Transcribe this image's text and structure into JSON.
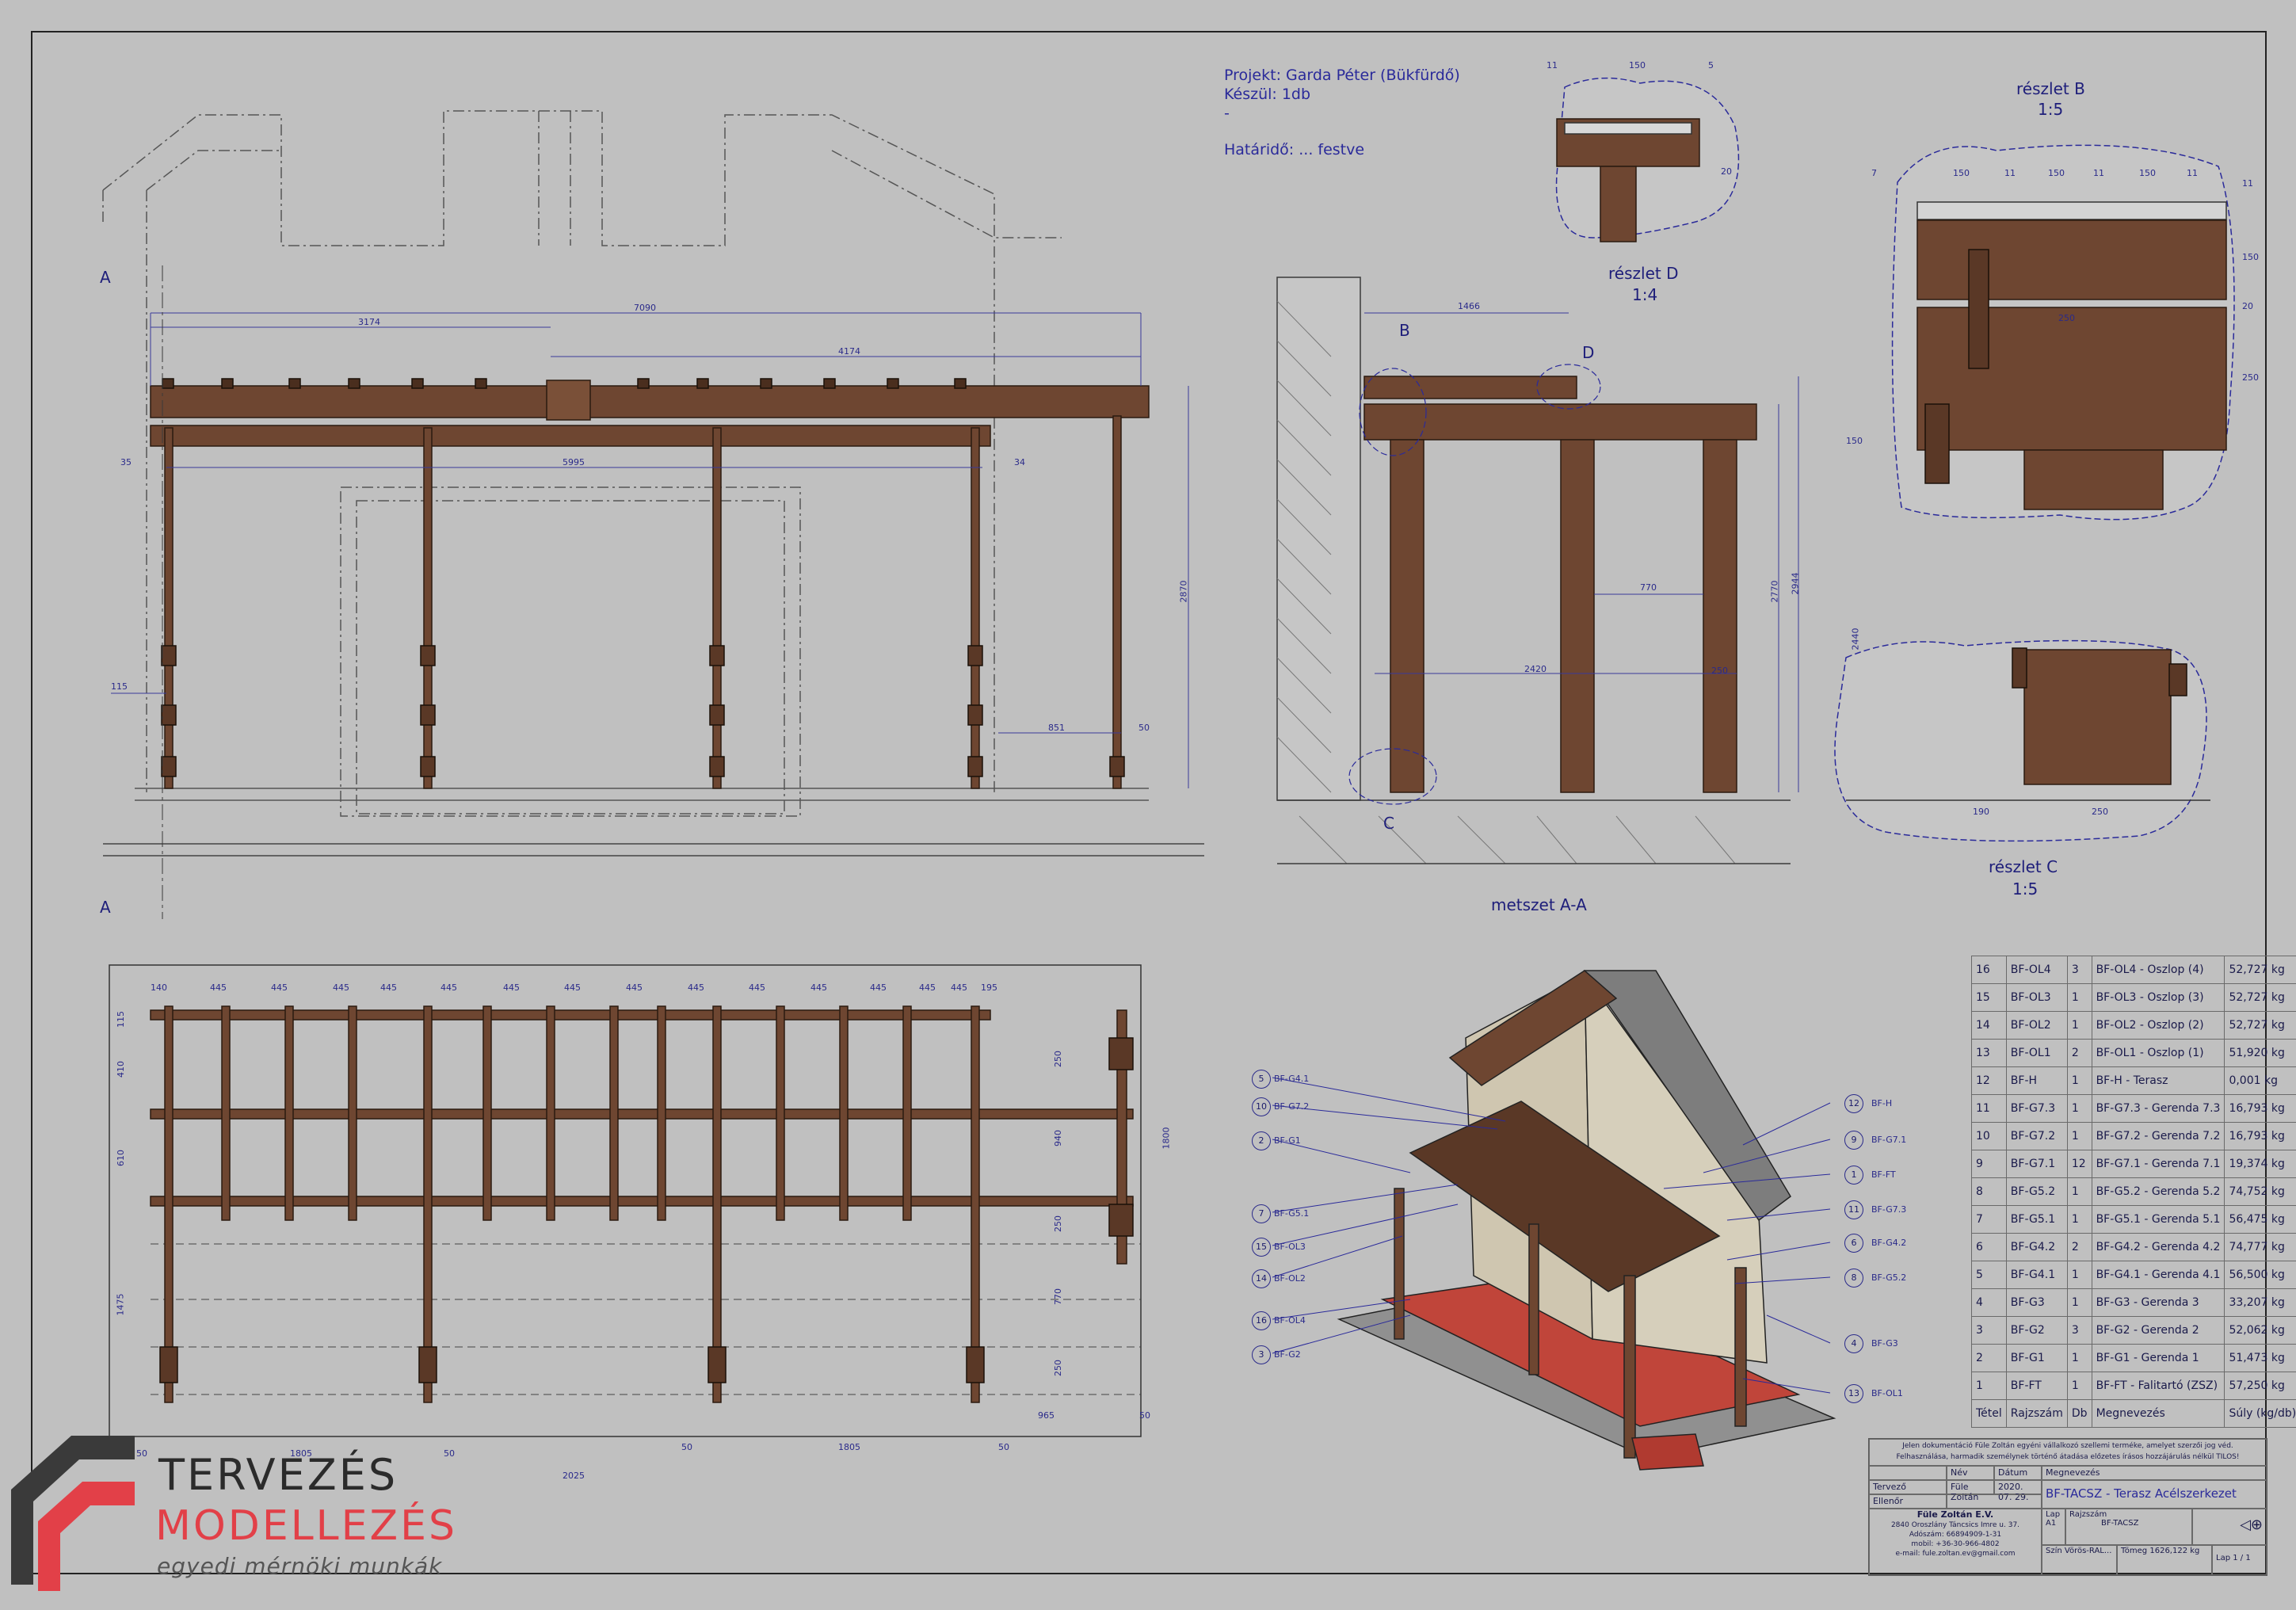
{
  "project": {
    "line1": "Projekt: Garda Péter (Bükfürdő)",
    "line2": "Készül: 1db",
    "line3": "-",
    "line4": "Határidő: ... festve"
  },
  "views": {
    "section_a": "A",
    "section_title": "metszet A-A",
    "detail_b_title": "részlet B",
    "detail_b_scale": "1:5",
    "detail_c_title": "részlet C",
    "detail_c_scale": "1:5",
    "detail_d_title": "részlet D",
    "detail_d_scale": "1:4",
    "callout_b": "B",
    "callout_c": "C",
    "callout_d": "D"
  },
  "dimensions": {
    "front": [
      "3174",
      "7090",
      "4174",
      "5995",
      "35",
      "34",
      "2870",
      "115",
      "851",
      "50"
    ],
    "section": [
      "1466",
      "770",
      "2420",
      "250",
      "2770",
      "2944"
    ],
    "detail_d": [
      "11",
      "150",
      "5",
      "20"
    ],
    "detail_b": [
      "7",
      "150",
      "11",
      "150",
      "11",
      "150",
      "11",
      "11",
      "150",
      "20",
      "250",
      "150",
      "250"
    ],
    "detail_c": [
      "2440",
      "190",
      "250"
    ],
    "plan": [
      "140",
      "445",
      "445",
      "445",
      "445",
      "445",
      "445",
      "445",
      "445",
      "445",
      "445",
      "445",
      "445",
      "445",
      "445",
      "195",
      "115",
      "410",
      "610",
      "1475",
      "250",
      "940",
      "250",
      "1800",
      "770",
      "250",
      "965",
      "50",
      "50",
      "1805",
      "50",
      "50",
      "1805",
      "50",
      "2025"
    ]
  },
  "balloons_left": [
    {
      "n": "5",
      "code": "BF-G4.1"
    },
    {
      "n": "10",
      "code": "BF-G7.2"
    },
    {
      "n": "2",
      "code": "BF-G1"
    },
    {
      "n": "7",
      "code": "BF-G5.1"
    },
    {
      "n": "15",
      "code": "BF-OL3"
    },
    {
      "n": "14",
      "code": "BF-OL2"
    },
    {
      "n": "16",
      "code": "BF-OL4"
    },
    {
      "n": "3",
      "code": "BF-G2"
    }
  ],
  "balloons_right": [
    {
      "n": "12",
      "code": "BF-H"
    },
    {
      "n": "9",
      "code": "BF-G7.1"
    },
    {
      "n": "1",
      "code": "BF-FT"
    },
    {
      "n": "11",
      "code": "BF-G7.3"
    },
    {
      "n": "6",
      "code": "BF-G4.2"
    },
    {
      "n": "8",
      "code": "BF-G5.2"
    },
    {
      "n": "4",
      "code": "BF-G3"
    },
    {
      "n": "13",
      "code": "BF-OL1"
    }
  ],
  "bom": {
    "rows": [
      [
        "16",
        "BF-OL4",
        "3",
        "BF-OL4 - Oszlop (4)",
        "52,727 kg"
      ],
      [
        "15",
        "BF-OL3",
        "1",
        "BF-OL3 - Oszlop (3)",
        "52,727 kg"
      ],
      [
        "14",
        "BF-OL2",
        "1",
        "BF-OL2 - Oszlop (2)",
        "52,727 kg"
      ],
      [
        "13",
        "BF-OL1",
        "2",
        "BF-OL1 - Oszlop (1)",
        "51,920 kg"
      ],
      [
        "12",
        "BF-H",
        "1",
        "BF-H - Terasz",
        "0,001 kg"
      ],
      [
        "11",
        "BF-G7.3",
        "1",
        "BF-G7.3 - Gerenda 7.3",
        "16,793 kg"
      ],
      [
        "10",
        "BF-G7.2",
        "1",
        "BF-G7.2 - Gerenda 7.2",
        "16,793 kg"
      ],
      [
        "9",
        "BF-G7.1",
        "12",
        "BF-G7.1 - Gerenda 7.1",
        "19,374 kg"
      ],
      [
        "8",
        "BF-G5.2",
        "1",
        "BF-G5.2 - Gerenda 5.2",
        "74,752 kg"
      ],
      [
        "7",
        "BF-G5.1",
        "1",
        "BF-G5.1 - Gerenda 5.1",
        "56,475 kg"
      ],
      [
        "6",
        "BF-G4.2",
        "2",
        "BF-G4.2 - Gerenda 4.2",
        "74,777 kg"
      ],
      [
        "5",
        "BF-G4.1",
        "1",
        "BF-G4.1 - Gerenda 4.1",
        "56,500 kg"
      ],
      [
        "4",
        "BF-G3",
        "1",
        "BF-G3 - Gerenda 3",
        "33,207 kg"
      ],
      [
        "3",
        "BF-G2",
        "3",
        "BF-G2 - Gerenda 2",
        "52,062 kg"
      ],
      [
        "2",
        "BF-G1",
        "1",
        "BF-G1 - Gerenda 1",
        "51,473 kg"
      ],
      [
        "1",
        "BF-FT",
        "1",
        "BF-FT - Falitartó (ZSZ)",
        "57,250 kg"
      ]
    ],
    "header": [
      "Tétel",
      "Rajzszám",
      "Db",
      "Megnevezés",
      "Súly (kg/db)"
    ]
  },
  "title_block": {
    "notice_1": "Jelen dokumentáció Füle Zoltán egyéni vállalkozó szellemi terméke, amelyet szerzői jog véd.",
    "notice_2": "Felhasználása, harmadik személynek történő átadása előzetes írásos hozzájárulás nélkül TILOS!",
    "col_nev": "Név",
    "col_datum": "Dátum",
    "col_megnevezes": "Megnevezés",
    "row_tervezo": "Tervező",
    "tervezo_name": "Füle Zoltán",
    "tervezo_date": "2020. 07. 29.",
    "row_ellenor": "Ellenőr",
    "drawing_title": "BF-TACSZ - Terasz Acélszerkezet",
    "company": "Füle Zoltán E.V.",
    "addr1": "2840 Oroszlány Táncsics Imre u. 37.",
    "addr2": "Adószám: 66894909-1-31",
    "addr3": "mobil: +36-30-966-4802",
    "addr4": "e-mail: fule.zoltan.ev@gmail.com",
    "lbl_rajzszam": "Rajzszám",
    "rajzszam": "BF-TACSZ",
    "lbl_lap": "Lap",
    "lap_size": "A1",
    "lbl_szin": "Szín",
    "szin": "Vörös-RAL...",
    "lbl_tomeg": "Tömeg",
    "tomeg": "1626,122 kg",
    "lapszam": "Lap 1 / 1"
  },
  "logo": {
    "line1": "TERVEZÉS",
    "line2": "MODELLEZÉS",
    "line3": "egyedi mérnöki munkák"
  }
}
